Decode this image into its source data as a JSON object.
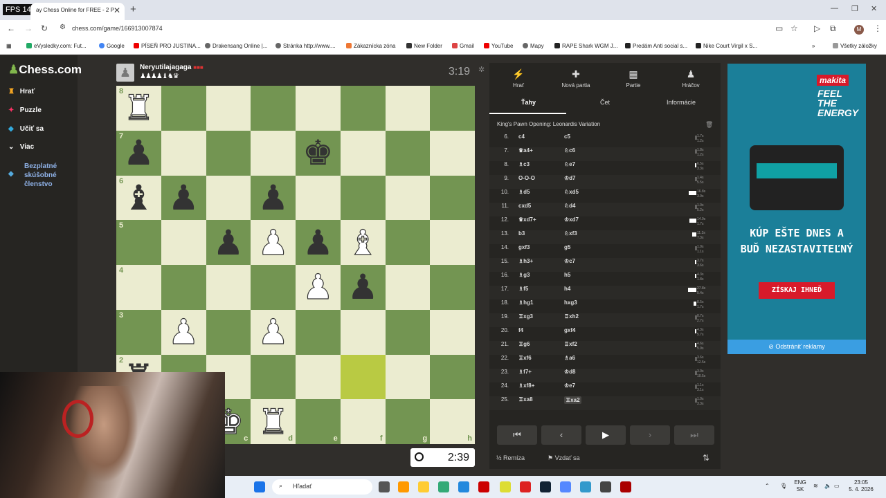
{
  "browser": {
    "fps": "FPS 148",
    "tab_title": "ay Chess Online for FREE - 2 P",
    "url": "chess.com/game/166913007874",
    "bookmarks": [
      "eVysledky.com: Fut...",
      "Google",
      "PÍSEŇ PRO JUSTINA...",
      "Drakensang Online |...",
      "Stránka http://www....",
      "Zákaznícka zóna",
      "New Folder",
      "Gmail",
      "YouTube",
      "Mapy",
      "RAPE Shark WGM J...",
      "Predám Anti social s...",
      "Nike Court Virgil x S..."
    ],
    "bookmarks_all": "Všetky záložky"
  },
  "sidebar": {
    "logo": "Chess.com",
    "items": [
      {
        "label": "Hrať"
      },
      {
        "label": "Puzzle"
      },
      {
        "label": "Učiť sa"
      },
      {
        "label": "Viac"
      }
    ],
    "promo": "Bezplatné skúšobné členstvo"
  },
  "opponent": {
    "name": "Neryutilajagaga",
    "material": "♟♟♟♟♝♞♛",
    "clock": "3:19"
  },
  "player": {
    "clock": "2:39"
  },
  "board": {
    "rows": [
      [
        "wR",
        "",
        "",
        "",
        "",
        "",
        "",
        ""
      ],
      [
        "bP",
        "",
        "",
        "",
        "bK",
        "",
        "",
        ""
      ],
      [
        "bB",
        "bP",
        "",
        "bP",
        "",
        "",
        "",
        ""
      ],
      [
        "",
        "",
        "bP",
        "wP",
        "bP",
        "wB",
        "",
        ""
      ],
      [
        "",
        "",
        "",
        "",
        "wP",
        "bP",
        "",
        ""
      ],
      [
        "",
        "wP",
        "",
        "wP",
        "",
        "",
        "",
        ""
      ],
      [
        "bR",
        "",
        "",
        "",
        "",
        "HL",
        "",
        ""
      ],
      [
        "",
        "",
        "wK",
        "wR",
        "",
        "",
        "",
        ""
      ]
    ],
    "ranks": [
      "8",
      "7",
      "6",
      "5",
      "4",
      "3",
      "2",
      "1"
    ],
    "files": [
      "a",
      "b",
      "c",
      "d",
      "e",
      "f",
      "g",
      "h"
    ]
  },
  "panel": {
    "tabs": [
      {
        "label": "Hrať",
        "icon": "⚡"
      },
      {
        "label": "Nová partia",
        "icon": "✚"
      },
      {
        "label": "Partie",
        "icon": "▦"
      },
      {
        "label": "Hráčov",
        "icon": "♟"
      }
    ],
    "subtabs": [
      "Ťahy",
      "Čet",
      "Informácie"
    ],
    "opening": "King's Pawn Opening: Leonardis Variation",
    "moves": [
      {
        "n": "6.",
        "w": "c4",
        "b": "c5",
        "t1": "1.7s",
        "t2": "1.2s",
        "bar": 0.05
      },
      {
        "n": "7.",
        "w": "♛a4+",
        "b": "♘c6",
        "t1": "1.8s",
        "t2": "1.2s",
        "bar": 0.05
      },
      {
        "n": "8.",
        "w": "♗c3",
        "b": "♘e7",
        "t1": "6.5s",
        "t2": "3.3s",
        "bar": 0.2
      },
      {
        "n": "9.",
        "w": "O-O-O",
        "b": "♔d7",
        "t1": "1.4s",
        "t2": "5.5s",
        "bar": 0.05
      },
      {
        "n": "10.",
        "w": "♗d5",
        "b": "♘xd5",
        "t1": "16.8s",
        "t2": "3.9s",
        "bar": 0.9
      },
      {
        "n": "11.",
        "w": "cxd5",
        "b": "♘d4",
        "t1": "1.0s",
        "t2": "5.2s",
        "bar": 0.05
      },
      {
        "n": "12.",
        "w": "♛xd7+",
        "b": "♔xd7",
        "t1": "14.9s",
        "t2": "1.7s",
        "bar": 0.8
      },
      {
        "n": "13.",
        "w": "b3",
        "b": "♘xf3",
        "t1": "11.3s",
        "t2": "7.3s",
        "bar": 0.5
      },
      {
        "n": "14.",
        "w": "gxf3",
        "b": "g5",
        "t1": "1.0s",
        "t2": "1.1s",
        "bar": 0.05
      },
      {
        "n": "15.",
        "w": "♗h3+",
        "b": "♔c7",
        "t1": "3.7s",
        "t2": "3.6s",
        "bar": 0.15
      },
      {
        "n": "16.",
        "w": "♗g3",
        "b": "h5",
        "t1": "4.3s",
        "t2": "1.8s",
        "bar": 0.15
      },
      {
        "n": "17.",
        "w": "♗f5",
        "b": "h4",
        "t1": "27.8s",
        "t2": "5.4s",
        "bar": 1
      },
      {
        "n": "18.",
        "w": "♗hg1",
        "b": "hxg3",
        "t1": "8.5s",
        "t2": "1.7s",
        "bar": 0.3
      },
      {
        "n": "19.",
        "w": "♖xg3",
        "b": "♖xh2",
        "t1": "0.7s",
        "t2": "2.7s",
        "bar": 0.05
      },
      {
        "n": "20.",
        "w": "f4",
        "b": "gxf4",
        "t1": "4.3s",
        "t2": "5.7s",
        "bar": 0.15
      },
      {
        "n": "21.",
        "w": "♖g6",
        "b": "♖xf2",
        "t1": "4.6s",
        "t2": "5.9s",
        "bar": 0.15
      },
      {
        "n": "22.",
        "w": "♖xf6",
        "b": "♗a6",
        "t1": "3.6s",
        "t2": "12.5s",
        "bar": 0.1
      },
      {
        "n": "23.",
        "w": "♗f7+",
        "b": "♔d8",
        "t1": "3.0s",
        "t2": "10.5s",
        "bar": 0.1
      },
      {
        "n": "24.",
        "w": "♗xf8+",
        "b": "♔e7",
        "t1": "1.1s",
        "t2": "3.1s",
        "bar": 0.05
      },
      {
        "n": "25.",
        "w": "♖xa8",
        "b": "♖xa2",
        "t1": "1.0s",
        "t2": "3.3s",
        "bar": 0.05
      }
    ],
    "nav": [
      "⏮",
      "‹",
      "▶",
      "›",
      "⏭"
    ],
    "draw": "½ Remíza",
    "resign": "⚑ Vzdať sa"
  },
  "ad": {
    "brand": "makita",
    "tagline": "FEEL THE ENERGY",
    "headline": "KÚP EŠTE DNES A BUĎ NEZASTAVITEĽNÝ",
    "cta": "ZÍSKAJ IHNEĎ",
    "remove": "Odstrániť reklamy"
  },
  "taskbar": {
    "search": "Hľadať",
    "lang": "ENG SK",
    "time": "23:05",
    "date": "5. 4. 2026"
  }
}
